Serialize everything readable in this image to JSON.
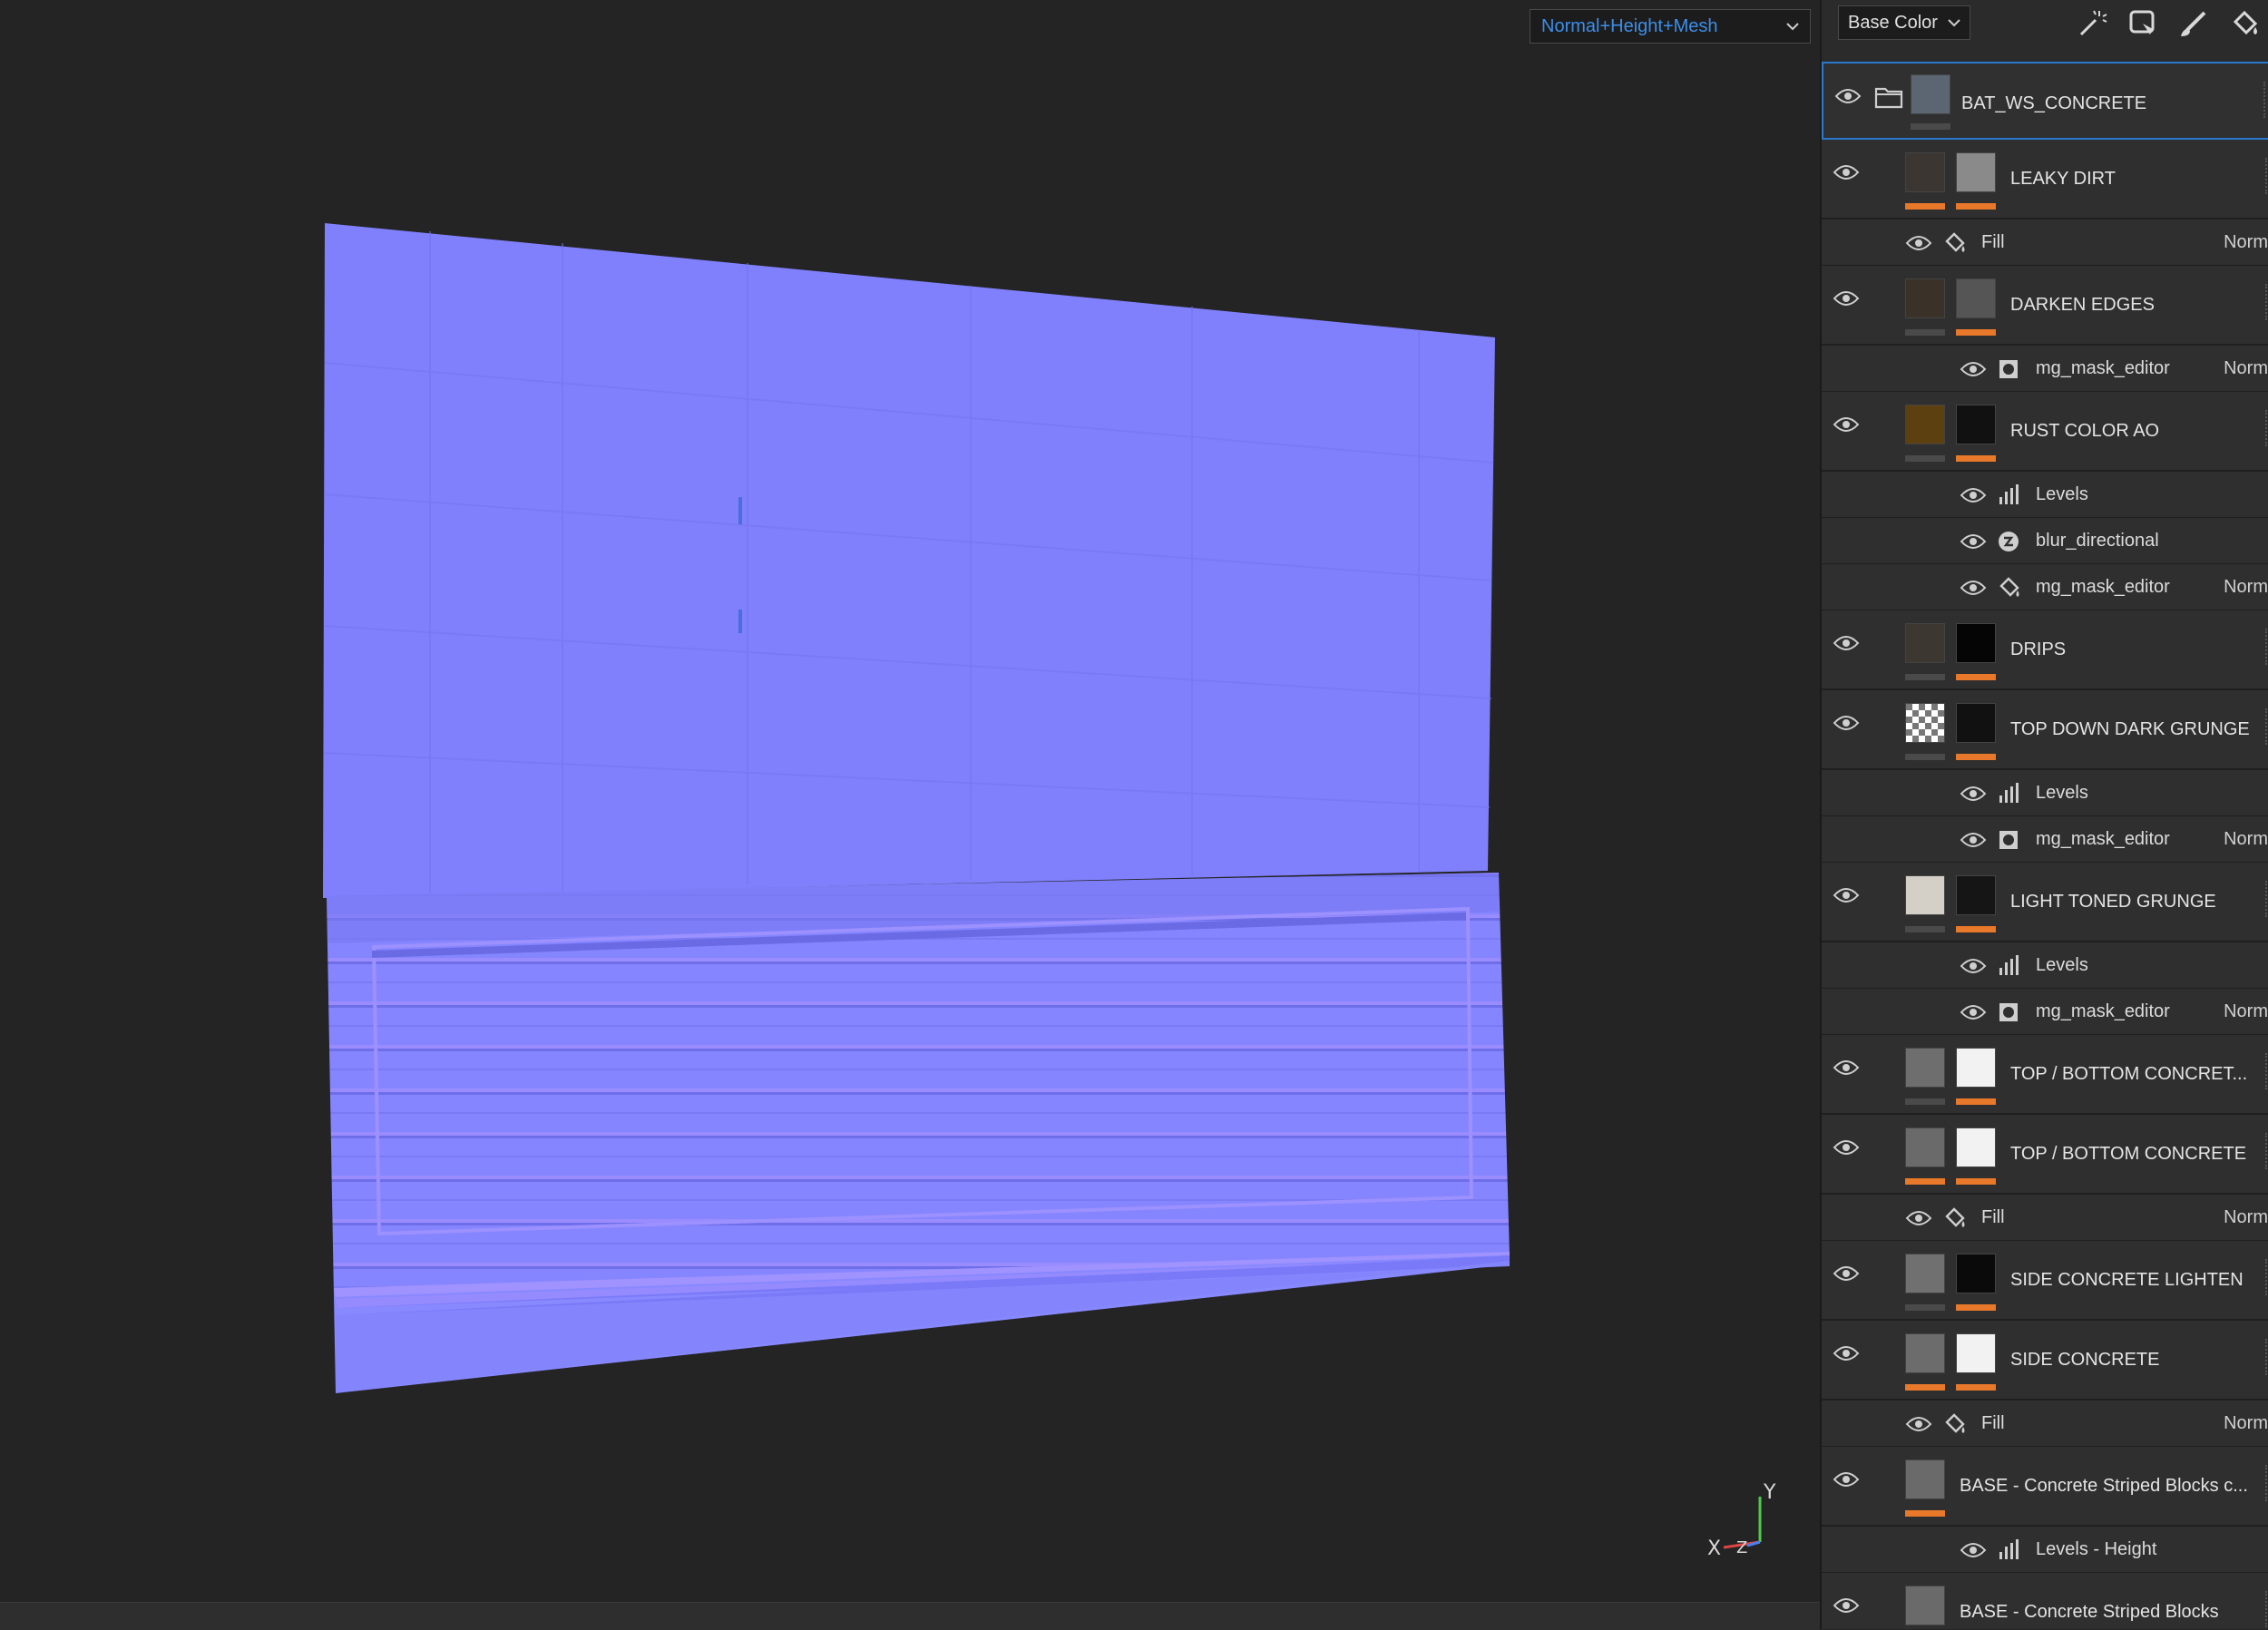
{
  "viewport": {
    "view_mode": "Normal+Height+Mesh",
    "axes": {
      "x": "X",
      "y": "Y",
      "z": "Z"
    },
    "colors": {
      "normal_map": "#8080ff",
      "background": "#242424"
    }
  },
  "toolbar": {
    "channel": "Base Color",
    "tools": [
      "magic-wand-icon",
      "lasso-icon",
      "brush-icon",
      "paint-bucket-icon"
    ]
  },
  "layers": [
    {
      "name": "BAT_WS_CONCRETE",
      "kind": "folder",
      "selected": true,
      "subs": []
    },
    {
      "name": "LEAKY DIRT",
      "kind": "fill",
      "subs": [
        {
          "label": "Fill",
          "icon": "fill-icon",
          "blend": "Norm"
        }
      ]
    },
    {
      "name": "DARKEN EDGES",
      "kind": "fill",
      "subs": [
        {
          "label": "mg_mask_editor",
          "icon": "mask-icon",
          "blend": "Norm"
        }
      ]
    },
    {
      "name": "RUST COLOR AO",
      "kind": "fill",
      "subs": [
        {
          "label": "Levels",
          "icon": "levels-icon",
          "blend": ""
        },
        {
          "label": "blur_directional",
          "icon": "substance-icon",
          "blend": ""
        },
        {
          "label": "mg_mask_editor",
          "icon": "fill-icon",
          "blend": "Norm"
        }
      ]
    },
    {
      "name": "DRIPS",
      "kind": "fill",
      "subs": []
    },
    {
      "name": "TOP DOWN DARK GRUNGE",
      "kind": "fill",
      "subs": [
        {
          "label": "Levels",
          "icon": "levels-icon",
          "blend": ""
        },
        {
          "label": "mg_mask_editor",
          "icon": "mask-icon",
          "blend": "Norm"
        }
      ]
    },
    {
      "name": "LIGHT TONED GRUNGE",
      "kind": "fill",
      "subs": [
        {
          "label": "Levels",
          "icon": "levels-icon",
          "blend": ""
        },
        {
          "label": "mg_mask_editor",
          "icon": "mask-icon",
          "blend": "Norm"
        }
      ]
    },
    {
      "name": "TOP / BOTTOM CONCRET...",
      "kind": "fill",
      "subs": []
    },
    {
      "name": "TOP / BOTTOM CONCRETE",
      "kind": "fill",
      "subs": [
        {
          "label": "Fill",
          "icon": "fill-icon",
          "blend": "Norm"
        }
      ]
    },
    {
      "name": "SIDE CONCRETE LIGHTEN",
      "kind": "fill",
      "subs": []
    },
    {
      "name": "SIDE CONCRETE",
      "kind": "fill",
      "subs": [
        {
          "label": "Fill",
          "icon": "fill-icon",
          "blend": "Norm"
        }
      ]
    },
    {
      "name": "BASE - Concrete Striped Blocks c...",
      "kind": "fill",
      "subs": [
        {
          "label": "Levels - Height",
          "icon": "levels-icon",
          "blend": ""
        }
      ]
    },
    {
      "name": "BASE - Concrete Striped Blocks",
      "kind": "fill",
      "subs": []
    }
  ]
}
